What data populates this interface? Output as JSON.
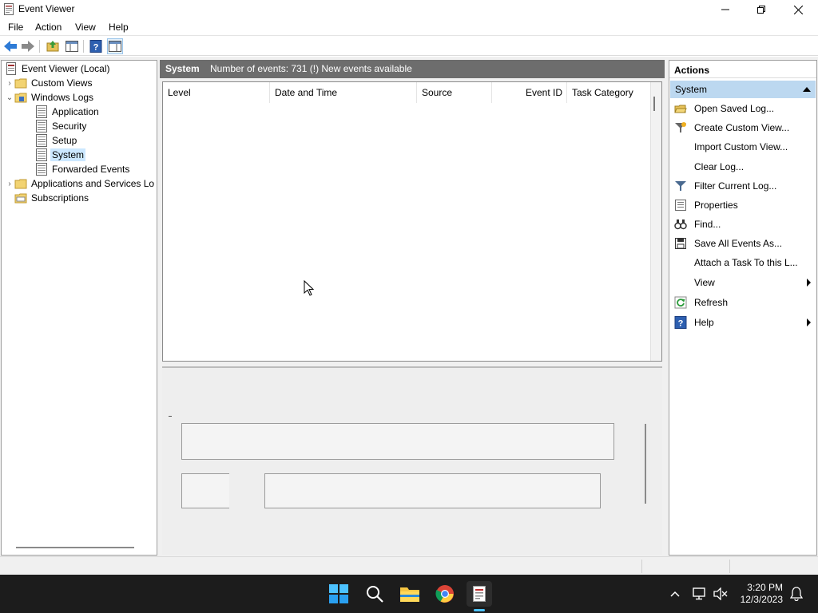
{
  "window": {
    "title": "Event Viewer",
    "app_icon": "event-viewer-icon"
  },
  "menu": {
    "file": "File",
    "action": "Action",
    "view": "View",
    "help": "Help"
  },
  "tree": {
    "root": "Event Viewer (Local)",
    "custom_views": "Custom Views",
    "windows_logs": "Windows Logs",
    "application": "Application",
    "security": "Security",
    "setup": "Setup",
    "system": "System",
    "forwarded_events": "Forwarded Events",
    "apps_services": "Applications and Services Lo",
    "subscriptions": "Subscriptions"
  },
  "center": {
    "log_name": "System",
    "event_summary": "Number of events: 731 (!) New events available",
    "columns": [
      "Level",
      "Date and Time",
      "Source",
      "Event ID",
      "Task Category"
    ]
  },
  "actions": {
    "header": "Actions",
    "section": "System",
    "items": [
      "Open Saved Log...",
      "Create Custom View...",
      "Import Custom View...",
      "Clear Log...",
      "Filter Current Log...",
      "Properties",
      "Find...",
      "Save All Events As...",
      "Attach a Task To this L...",
      "View",
      "Refresh",
      "Help"
    ]
  },
  "taskbar": {
    "time": "3:20 PM",
    "date": "12/3/2023"
  },
  "colors": {
    "accent": "#0078d4",
    "selection": "#cce8ff",
    "actions_section": "#bcd8f0",
    "center_header": "#6d6d6d",
    "taskbar": "#1c1c1c"
  }
}
